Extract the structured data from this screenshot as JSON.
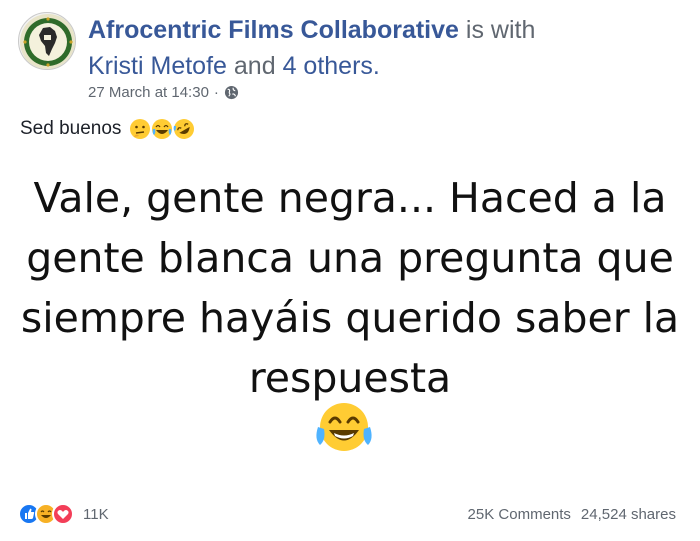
{
  "post": {
    "author": "Afrocentric Films Collaborative",
    "with_text": "is with",
    "tagged_person": "Kristi Metofe",
    "and_text": "and",
    "others": "4 others.",
    "timestamp": "27 March at 14:30",
    "separator": "·",
    "privacy_icon": "globe-icon",
    "caption": "Sed buenos",
    "caption_emojis": [
      "thinking-face",
      "joy-face",
      "rofl-face"
    ],
    "meme_text": "Vale, gente negra... Haced a la gente blanca una pregunta que siempre hayáis querido saber la respuesta",
    "meme_emoji": "joy-face"
  },
  "reactions": {
    "icons": [
      "like-icon",
      "haha-icon",
      "love-icon"
    ],
    "count": "11K"
  },
  "stats": {
    "comments": "25K Comments",
    "shares": "24,524 shares"
  },
  "colors": {
    "link": "#385898",
    "muted": "#606770",
    "like": "#1877f2",
    "haha": "#f7b125",
    "love": "#f33e58"
  }
}
